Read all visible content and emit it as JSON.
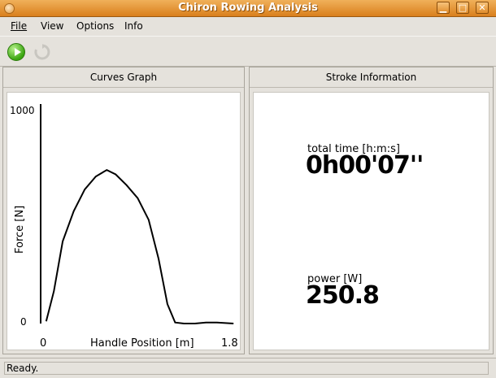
{
  "window": {
    "title": "Chiron Rowing Analysis"
  },
  "menu": {
    "file": "File",
    "view": "View",
    "options": "Options",
    "info": "Info"
  },
  "toolbar": {
    "play_icon": "play-icon",
    "refresh_icon": "refresh-icon"
  },
  "curves_panel": {
    "title": "Curves Graph"
  },
  "stroke_panel": {
    "title": "Stroke Information",
    "total_time_label": "total time [h:m:s]",
    "total_time_value": "0h00'07''",
    "power_label": "power [W]",
    "power_value": "250.8"
  },
  "status": {
    "text": "Ready."
  },
  "chart_data": {
    "type": "line",
    "xlabel": "Handle Position [m]",
    "ylabel": "Force [N]",
    "xlim": [
      0,
      1.8
    ],
    "ylim": [
      0,
      1000
    ],
    "x_tick_labels": [
      "0",
      "1.8"
    ],
    "y_tick_labels": [
      "0",
      "1000"
    ],
    "series": [
      {
        "x": [
          0.05,
          0.12,
          0.2,
          0.3,
          0.4,
          0.5,
          0.6,
          0.68,
          0.78,
          0.88,
          0.98,
          1.07,
          1.15,
          1.22,
          1.3,
          1.4,
          1.5,
          1.6,
          1.75
        ],
        "values": [
          10,
          150,
          380,
          520,
          620,
          680,
          710,
          690,
          640,
          580,
          480,
          300,
          90,
          5,
          0,
          0,
          5,
          5,
          0
        ]
      }
    ]
  }
}
